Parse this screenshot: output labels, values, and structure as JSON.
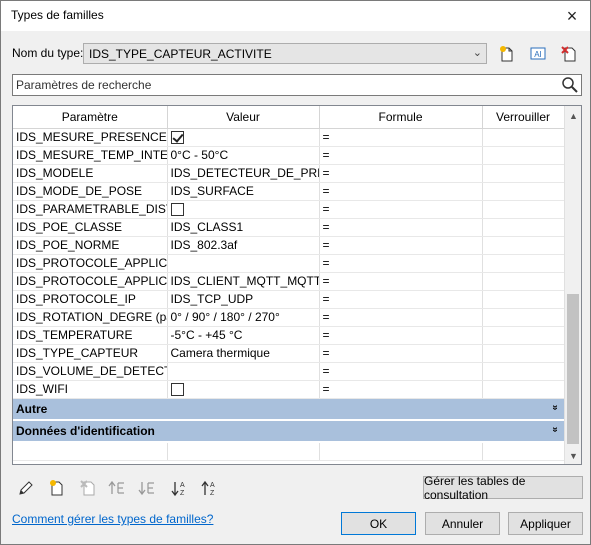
{
  "window": {
    "title": "Types de familles",
    "close_label": "×"
  },
  "type_selector": {
    "label": "Nom du type:",
    "value": "IDS_TYPE_CAPTEUR_ACTIVITE"
  },
  "toolbar": {
    "icons": [
      "new-type-icon",
      "rename-type-icon",
      "delete-type-icon"
    ],
    "rename_glyph": "AI"
  },
  "search": {
    "placeholder": "Paramètres de recherche"
  },
  "grid": {
    "headers": {
      "param": "Paramètre",
      "value": "Valeur",
      "formula": "Formule",
      "lock": "Verrouiller"
    },
    "rows": [
      {
        "param": "IDS_MESURE_PRESENCE",
        "value": "",
        "checkbox": true,
        "checked": true,
        "formula": "="
      },
      {
        "param": "IDS_MESURE_TEMP_INTERIE",
        "value": "0°C - 50°C",
        "formula": "="
      },
      {
        "param": "IDS_MODELE",
        "value": "IDS_DETECTEUR_DE_PRESEN",
        "formula": "="
      },
      {
        "param": "IDS_MODE_DE_POSE",
        "value": "IDS_SURFACE",
        "formula": "="
      },
      {
        "param": "IDS_PARAMETRABLE_DISTA",
        "value": "",
        "checkbox": true,
        "checked": false,
        "formula": "="
      },
      {
        "param": "IDS_POE_CLASSE",
        "value": "IDS_CLASS1",
        "formula": "="
      },
      {
        "param": "IDS_POE_NORME",
        "value": "IDS_802.3af",
        "formula": "="
      },
      {
        "param": "IDS_PROTOCOLE_APPLICATI",
        "value": "",
        "formula": "="
      },
      {
        "param": "IDS_PROTOCOLE_APPLICATI",
        "value": "IDS_CLIENT_MQTT_MQTTS",
        "formula": "="
      },
      {
        "param": "IDS_PROTOCOLE_IP",
        "value": "IDS_TCP_UDP",
        "formula": "="
      },
      {
        "param": "IDS_ROTATION_DEGRE (par",
        "value": "0° / 90° / 180° / 270°",
        "formula": "="
      },
      {
        "param": "IDS_TEMPERATURE",
        "value": "-5°C - +45 °C",
        "formula": "="
      },
      {
        "param": "IDS_TYPE_CAPTEUR",
        "value": "Camera thermique",
        "formula": "="
      },
      {
        "param": "IDS_VOLUME_DE_DETECTIO",
        "value": "",
        "formula": "="
      },
      {
        "param": "IDS_WIFI",
        "value": "",
        "checkbox": true,
        "checked": false,
        "formula": "="
      }
    ],
    "groups": [
      {
        "label": "Autre",
        "chevron": "»"
      },
      {
        "label": "Données d'identification",
        "chevron": "»"
      }
    ]
  },
  "bottom_tools": [
    "edit-parameter-icon",
    "new-parameter-icon",
    "delete-parameter-icon",
    "move-up-icon",
    "move-down-icon",
    "sort-ascending-icon",
    "sort-descending-icon"
  ],
  "buttons": {
    "lookup": "Gérer les tables de consultation",
    "ok": "OK",
    "cancel": "Annuler",
    "apply": "Appliquer"
  },
  "help_link": "Comment gérer les types de familles?"
}
